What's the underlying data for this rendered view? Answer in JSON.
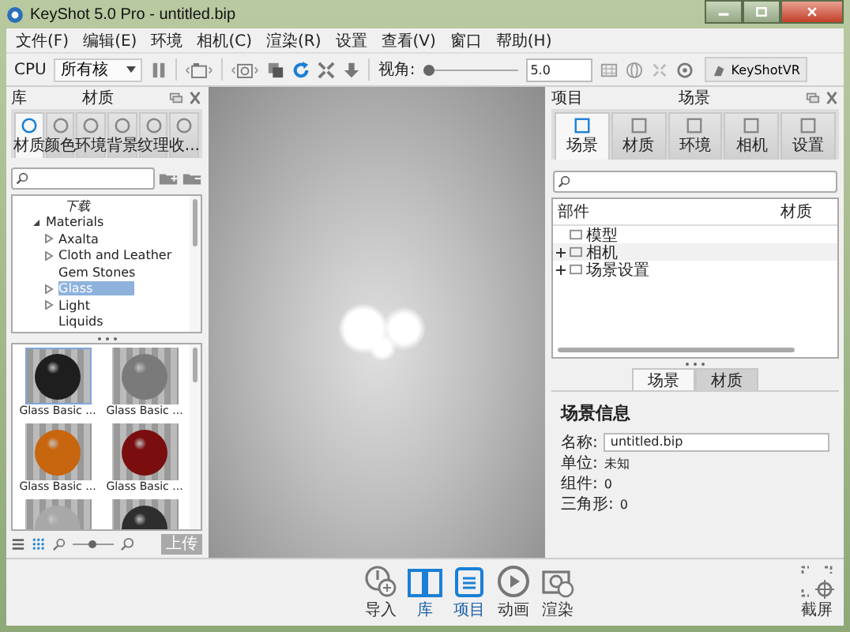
{
  "window": {
    "title": "KeyShot 5.0 Pro - untitled.bip"
  },
  "menu": [
    "文件(F)",
    "编辑(E)",
    "环境",
    "相机(C)",
    "渲染(R)",
    "设置",
    "查看(V)",
    "窗口",
    "帮助(H)"
  ],
  "toolbar": {
    "cpu_label": "CPU",
    "cpu_value": "所有核",
    "view_label": "视角:",
    "view_slider": {
      "level": 0.06
    },
    "view_value": "5.0",
    "vr_button": "KeyShotVR"
  },
  "library": {
    "title": "库",
    "subtitle": "材质",
    "tabs": [
      {
        "label": "材质",
        "selected": true
      },
      {
        "label": "颜色",
        "selected": false
      },
      {
        "label": "环境",
        "selected": false
      },
      {
        "label": "背景",
        "selected": false
      },
      {
        "label": "纹理",
        "selected": false
      },
      {
        "label": "收...",
        "selected": false
      }
    ],
    "tree": [
      {
        "label": "下载",
        "kind": "root",
        "selected": false
      },
      {
        "label": "Materials",
        "kind": "folder",
        "expanded": true,
        "selected": false,
        "children": [
          {
            "label": "Axalta",
            "kind": "folder",
            "expanded": false,
            "selected": false
          },
          {
            "label": "Cloth and Leather",
            "kind": "folder",
            "expanded": false,
            "selected": false
          },
          {
            "label": "Gem Stones",
            "kind": "leaf",
            "selected": false
          },
          {
            "label": "Glass",
            "kind": "folder",
            "expanded": false,
            "selected": true
          },
          {
            "label": "Light",
            "kind": "folder",
            "expanded": false,
            "selected": false
          },
          {
            "label": "Liquids",
            "kind": "leaf",
            "selected": false
          }
        ]
      }
    ],
    "thumbnails": [
      {
        "label": "Glass Basic ...",
        "color": "#1e1e1e",
        "selected": true
      },
      {
        "label": "Glass Basic ...",
        "color": "#7a7a7a",
        "selected": false
      },
      {
        "label": "Glass Basic ...",
        "color": "#c8650f",
        "selected": false
      },
      {
        "label": "Glass Basic ...",
        "color": "#7a0e0e",
        "selected": false
      },
      {
        "color": "#a8a8a8",
        "selected": false
      },
      {
        "color": "#2e2e2e",
        "selected": false
      }
    ],
    "thumbnail_size": {
      "level": 0.45
    },
    "upload_button": "上传"
  },
  "project": {
    "title": "项目",
    "subtitle": "场景",
    "tabs": [
      {
        "label": "场景",
        "selected": true
      },
      {
        "label": "材质",
        "selected": false
      },
      {
        "label": "环境",
        "selected": false
      },
      {
        "label": "相机",
        "selected": false
      },
      {
        "label": "设置",
        "selected": false
      }
    ],
    "columns": [
      "部件",
      "材质"
    ],
    "tree": [
      {
        "label": "模型",
        "expandable": false
      },
      {
        "label": "相机",
        "expandable": true
      },
      {
        "label": "场景设置",
        "expandable": true
      }
    ],
    "subtabs": [
      {
        "label": "场景",
        "selected": true
      },
      {
        "label": "材质",
        "selected": false
      }
    ],
    "info_title": "场景信息",
    "name_label": "名称:",
    "name_value": "untitled.bip",
    "fields": [
      {
        "label": "单位:",
        "value": "未知"
      },
      {
        "label": "组件:",
        "value": "0"
      },
      {
        "label": "三角形:",
        "value": "0"
      }
    ]
  },
  "bottom_bar": {
    "buttons": [
      {
        "label": "导入",
        "selected": false
      },
      {
        "label": "库",
        "selected": true
      },
      {
        "label": "项目",
        "selected": true
      },
      {
        "label": "动画",
        "selected": false
      },
      {
        "label": "渲染",
        "selected": false
      }
    ],
    "screenshot": "截屏"
  }
}
